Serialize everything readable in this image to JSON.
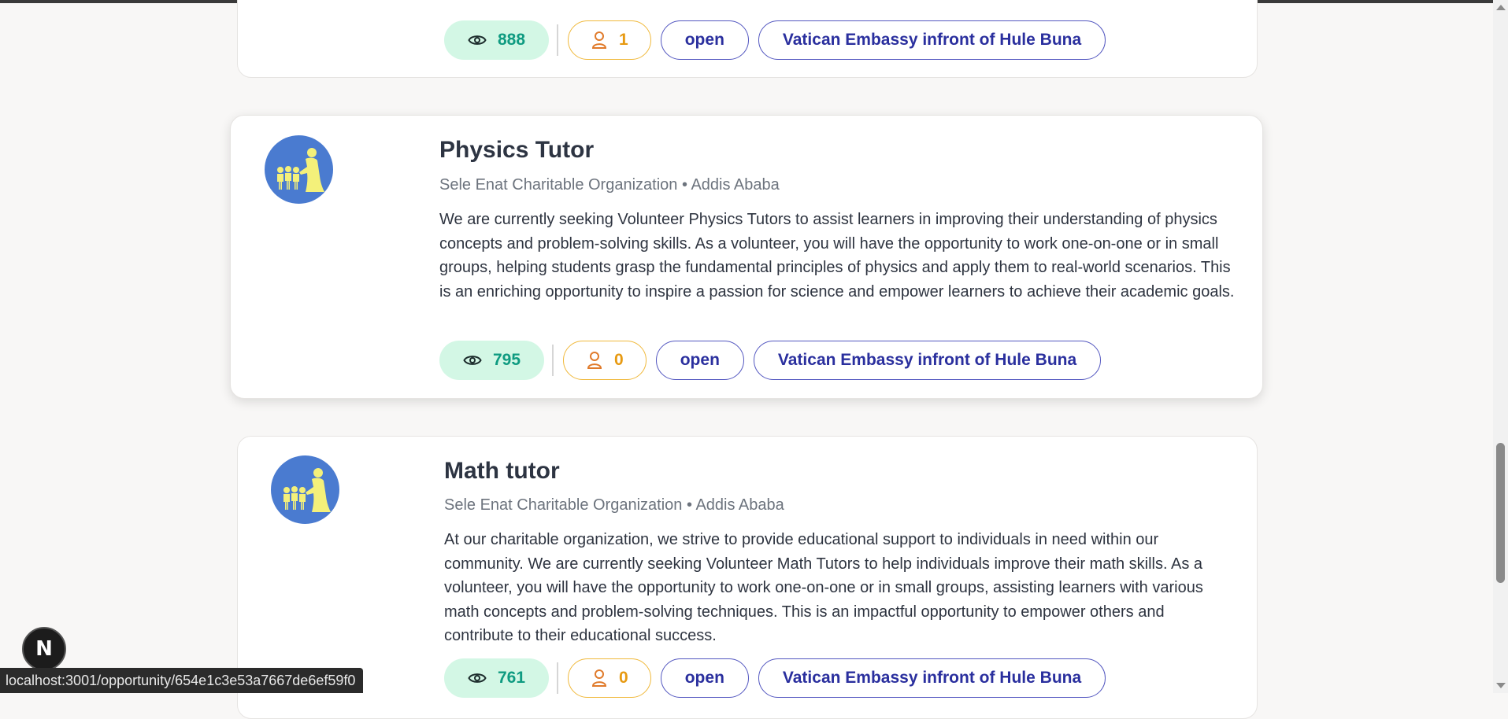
{
  "top_card": {
    "views": "888",
    "applicants": "1",
    "status": "open",
    "location": "Vatican Embassy infront of Hule Buna"
  },
  "cards": [
    {
      "title": "Physics Tutor",
      "organization": "Sele Enat Charitable Organization",
      "separator": "•",
      "city": "Addis Ababa",
      "description": "We are currently seeking Volunteer Physics Tutors to assist learners in improving their understanding of physics concepts and problem-solving skills. As a volunteer, you will have the opportunity to work one-on-one or in small groups, helping students grasp the fundamental principles of physics and apply them to real-world scenarios. This is an enriching opportunity to inspire a passion for science and empower learners to achieve their academic goals.",
      "views": "795",
      "applicants": "0",
      "status": "open",
      "location": "Vatican Embassy infront of Hule Buna"
    },
    {
      "title": "Math tutor",
      "organization": "Sele Enat Charitable Organization",
      "separator": "•",
      "city": "Addis Ababa",
      "description": "At our charitable organization, we strive to provide educational support to individuals in need within our community. We are currently seeking Volunteer Math Tutors to help individuals improve their math skills. As a volunteer, you will have the opportunity to work one-on-one or in small groups, assisting learners with various math concepts and problem-solving techniques. This is an impactful opportunity to empower others and contribute to their educational success.",
      "views": "761",
      "applicants": "0",
      "status": "open",
      "location": "Vatican Embassy infront of Hule Buna"
    }
  ],
  "dev_badge": {
    "label": "N"
  },
  "status_bar": {
    "url": "localhost:3001/opportunity/654e1c3e53a7667de6ef59f0"
  },
  "colors": {
    "page_bg": "#f8f7f6",
    "views_bg": "#d3f7e5",
    "views_text": "#0f9b81",
    "applicants_text": "#e79a12",
    "status_text": "#2a2f9e",
    "logo_bg": "#4a7bd0",
    "logo_figures": "#f4f07a"
  },
  "icons": {
    "views": "eye-icon",
    "applicants": "person-icon",
    "logo": "organization-logo"
  }
}
